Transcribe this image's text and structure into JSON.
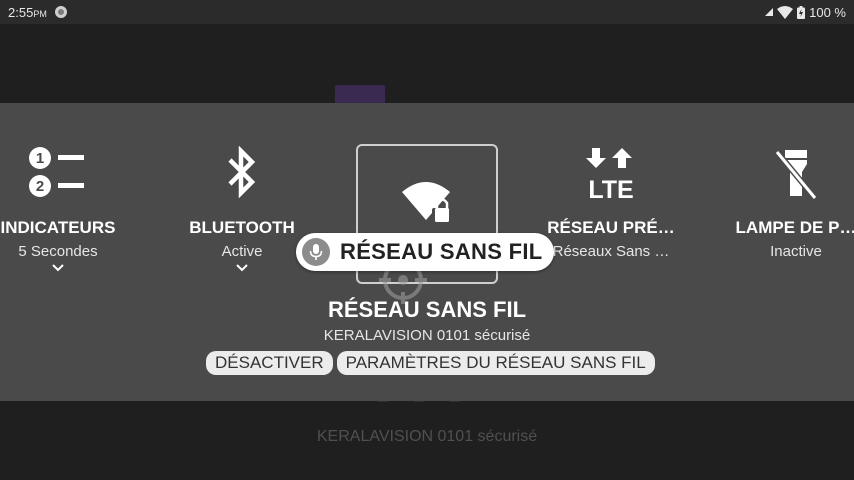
{
  "status_bar": {
    "time": "2:55",
    "ampm": "PM",
    "battery": "100 %",
    "icons": [
      "data-saver-icon",
      "signal-icon",
      "wifi-icon",
      "battery-icon"
    ]
  },
  "background_app": {
    "network_text": "KERALAVISION 0101 sécurisé"
  },
  "tiles": [
    {
      "title": "INDICATEURS",
      "subtitle": "5 Secondes",
      "icon": "numbered-list-icon",
      "expandable": true
    },
    {
      "title": "BLUETOOTH",
      "subtitle": "Active",
      "icon": "bluetooth-icon",
      "expandable": true
    },
    {
      "title": "RÉSEAU PRÉ…",
      "subtitle": "Réseaux Sans …",
      "icon": "lte-icon",
      "expandable": false
    },
    {
      "title": "LAMPE DE P…",
      "subtitle": "Inactive",
      "icon": "flashlight-off-icon",
      "expandable": false
    }
  ],
  "voice_prompt": {
    "label": "RÉSEAU SANS FIL",
    "icon": "mic-icon"
  },
  "focused": {
    "icon": "wifi-locked-icon",
    "title": "RÉSEAU SANS FIL",
    "subtitle": "KERALAVISION 0101 sécurisé",
    "actions": [
      "DÉSACTIVER",
      "PARAMÈTRES DU RÉSEAU SANS FIL"
    ]
  },
  "colors": {
    "panel": "#4a4a4a",
    "statusbar": "#2b2b2b",
    "background": "#1f1f1f",
    "pill": "#ffffff"
  }
}
